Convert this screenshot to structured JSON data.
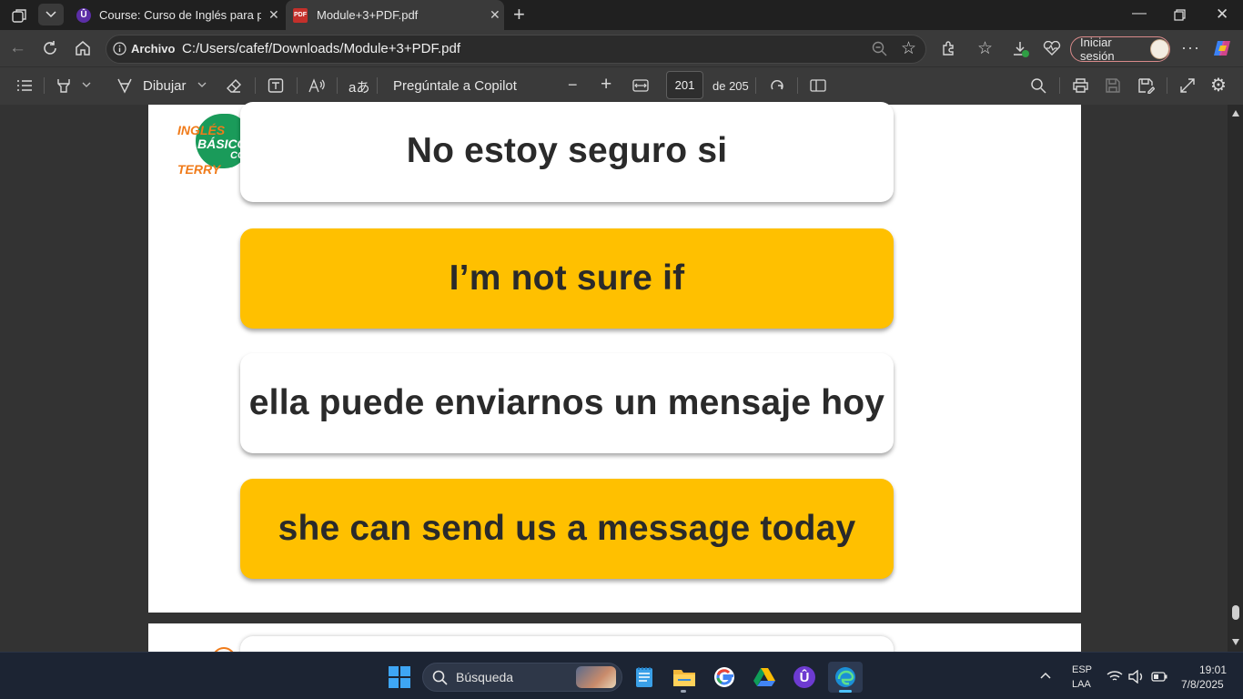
{
  "browser": {
    "tabs": [
      {
        "title": "Course: Curso de Inglés para prin",
        "favicon": "udemy-icon",
        "active": false
      },
      {
        "title": "Module+3+PDF.pdf",
        "favicon": "pdf-icon",
        "active": true
      }
    ],
    "address": {
      "site_label": "Archivo",
      "url": "C:/Users/cafef/Downloads/Module+3+PDF.pdf"
    },
    "signin_label": "Iniciar sesión"
  },
  "pdf_toolbar": {
    "draw_label": "Dibujar",
    "copilot_label": "Pregúntale a Copilot",
    "page_current": "201",
    "page_total_label": "de 205"
  },
  "document": {
    "logo": {
      "line1": "INGLÉS",
      "line2": "BÁSICO",
      "line3": "TERRY",
      "line4": "CO"
    },
    "cards": [
      {
        "text": "No estoy seguro si",
        "style": "white"
      },
      {
        "text": "I’m not sure if",
        "style": "yellow"
      },
      {
        "text": "ella puede enviarnos un mensaje hoy",
        "style": "white"
      },
      {
        "text": "she can send us a message today",
        "style": "yellow"
      }
    ]
  },
  "taskbar": {
    "search_placeholder": "Búsqueda",
    "lang_top": "ESP",
    "lang_bottom": "LAA",
    "time": "19:01",
    "date": "7/8/2025"
  },
  "colors": {
    "accent_yellow": "#ffc000",
    "card_text": "#2a2a2a",
    "logo_green": "#1a9b5a",
    "logo_orange": "#f07b1a"
  }
}
